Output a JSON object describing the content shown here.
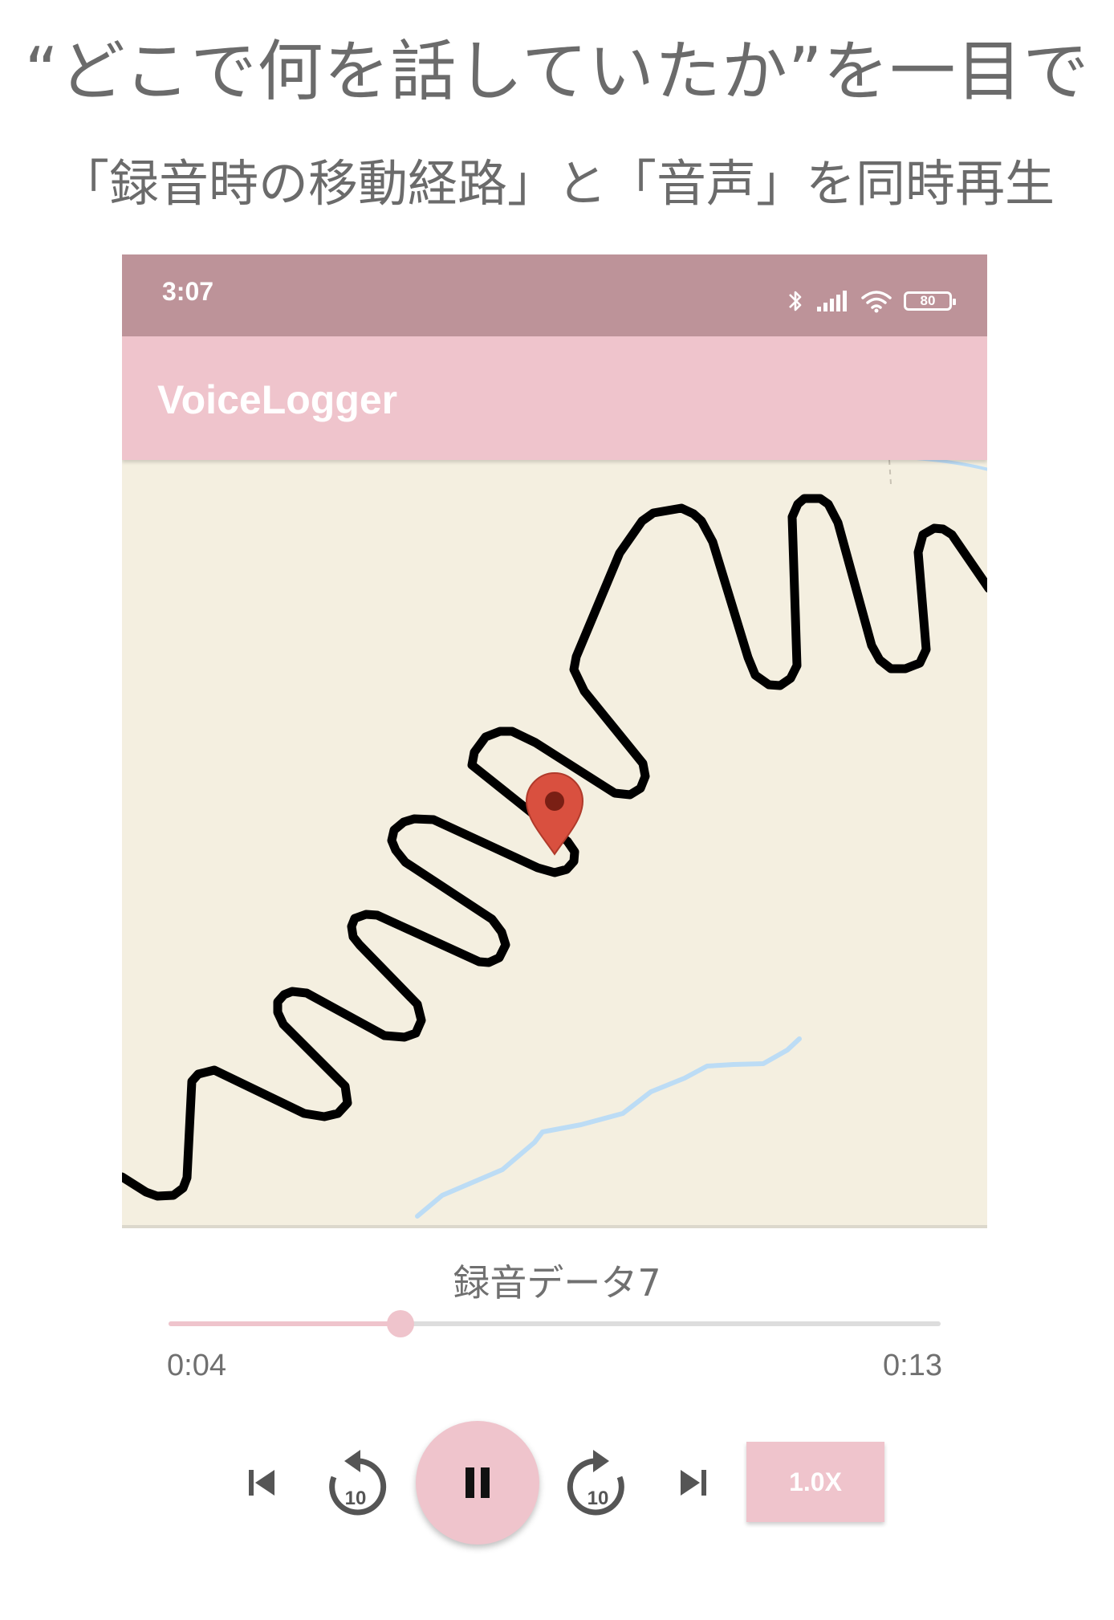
{
  "headline": {
    "title": "“どこで何を話していたか”を一目で",
    "subtitle": "「録音時の移動経路」と「音声」を同時再生"
  },
  "status_bar": {
    "time": "3:07",
    "battery": "80",
    "icons": [
      "bluetooth-icon",
      "signal-icon",
      "wifi-icon",
      "battery-icon"
    ]
  },
  "app_bar": {
    "title": "VoiceLogger"
  },
  "map": {
    "route_color": "#000000",
    "river_color": "#bcdcf5",
    "marker_color": "#d9503f",
    "background": "#f4efe0",
    "icons": [
      "location-pin-icon"
    ]
  },
  "player": {
    "track_title": "録音データ7",
    "current_time": "0:04",
    "total_time": "0:13",
    "progress": 0.3,
    "rewind_label": "10",
    "forward_label": "10",
    "speed_label": "1.0X",
    "accent": "#efc4cc",
    "icons": [
      "skip-previous-icon",
      "replay-10-icon",
      "pause-icon",
      "forward-10-icon",
      "skip-next-icon"
    ]
  }
}
